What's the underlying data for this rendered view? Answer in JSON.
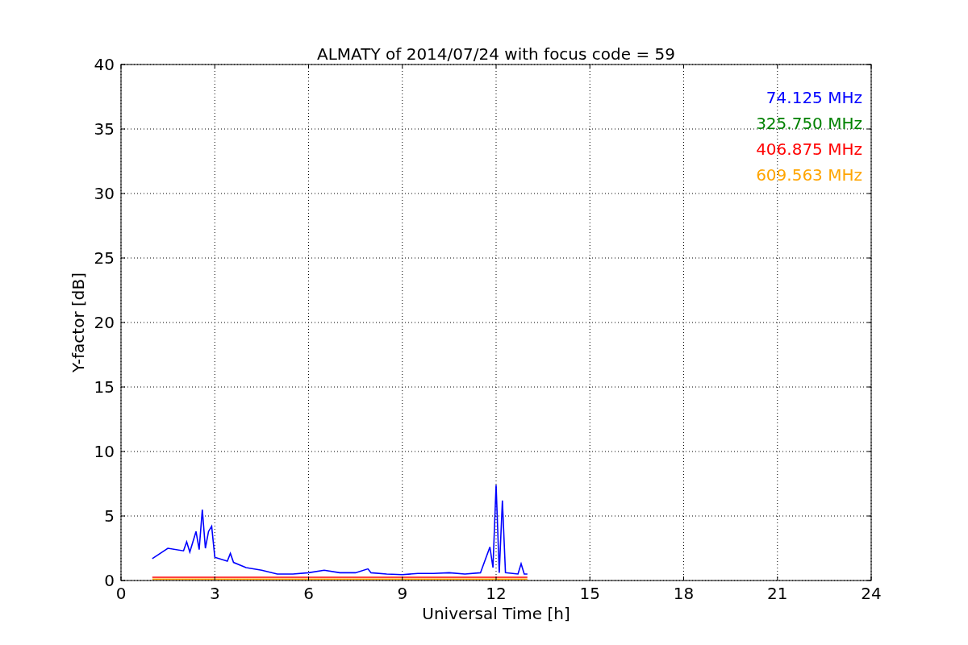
{
  "chart_data": {
    "type": "line",
    "title": "ALMATY of 2014/07/24 with focus code = 59",
    "xlabel": "Universal Time [h]",
    "ylabel": "Y-factor [dB]",
    "x": [
      1,
      1.5,
      2,
      2.1,
      2.2,
      2.4,
      2.5,
      2.6,
      2.7,
      2.8,
      2.9,
      3,
      3.4,
      3.5,
      3.6,
      4,
      4.5,
      5,
      5.5,
      6,
      6.5,
      7,
      7.5,
      7.9,
      8,
      8.5,
      9,
      9.5,
      10,
      10.5,
      11,
      11.5,
      11.8,
      11.9,
      12,
      12.1,
      12.2,
      12.3,
      12.7,
      12.8,
      12.9,
      13
    ],
    "series": [
      {
        "name": "74.125 MHz",
        "color": "#0000ff",
        "values": [
          1.7,
          2.5,
          2.3,
          3.0,
          2.2,
          3.8,
          2.4,
          5.5,
          2.5,
          3.8,
          4.2,
          1.8,
          1.5,
          2.1,
          1.4,
          1.0,
          0.8,
          0.5,
          0.5,
          0.6,
          0.8,
          0.6,
          0.6,
          0.9,
          0.6,
          0.5,
          0.45,
          0.55,
          0.55,
          0.6,
          0.5,
          0.6,
          2.6,
          1.0,
          7.4,
          0.6,
          6.2,
          0.6,
          0.5,
          1.3,
          0.5,
          0.5
        ]
      },
      {
        "name": "325.750 MHz",
        "color": "#008000",
        "values": [
          null,
          null,
          null,
          null,
          null,
          null,
          null,
          null,
          null,
          null,
          null,
          null,
          null,
          null,
          null,
          null,
          null,
          null,
          null,
          null,
          null,
          null,
          null,
          null,
          null,
          null,
          null,
          null,
          null,
          null,
          null,
          null,
          null,
          null,
          null,
          null,
          null,
          null,
          null,
          null,
          null,
          null
        ]
      },
      {
        "name": "406.875 MHz",
        "color": "#ff0000",
        "values": [
          0.25,
          0.25,
          0.25,
          0.25,
          0.25,
          0.25,
          0.25,
          0.25,
          0.25,
          0.25,
          0.25,
          0.25,
          0.25,
          0.25,
          0.25,
          0.25,
          0.25,
          0.25,
          0.25,
          0.25,
          0.25,
          0.25,
          0.25,
          0.25,
          0.25,
          0.25,
          0.25,
          0.25,
          0.25,
          0.25,
          0.25,
          0.25,
          0.25,
          0.25,
          0.25,
          0.25,
          0.25,
          0.25,
          0.25,
          0.25,
          0.25,
          0.25
        ]
      },
      {
        "name": "609.563 MHz",
        "color": "#ffa500",
        "values": [
          0.1,
          0.1,
          0.1,
          0.1,
          0.1,
          0.1,
          0.1,
          0.1,
          0.1,
          0.1,
          0.1,
          0.1,
          0.1,
          0.1,
          0.1,
          0.1,
          0.1,
          0.1,
          0.1,
          0.1,
          0.1,
          0.1,
          0.1,
          0.1,
          0.1,
          0.1,
          0.1,
          0.1,
          0.1,
          0.1,
          0.1,
          0.1,
          0.1,
          0.1,
          0.1,
          0.1,
          0.1,
          0.1,
          0.1,
          0.1,
          0.1,
          0.1
        ]
      }
    ],
    "xlim": [
      0,
      24
    ],
    "ylim": [
      0,
      40
    ],
    "xticks": [
      0,
      3,
      6,
      9,
      12,
      15,
      18,
      21,
      24
    ],
    "yticks": [
      0,
      5,
      10,
      15,
      20,
      25,
      30,
      35,
      40
    ],
    "grid": true
  }
}
